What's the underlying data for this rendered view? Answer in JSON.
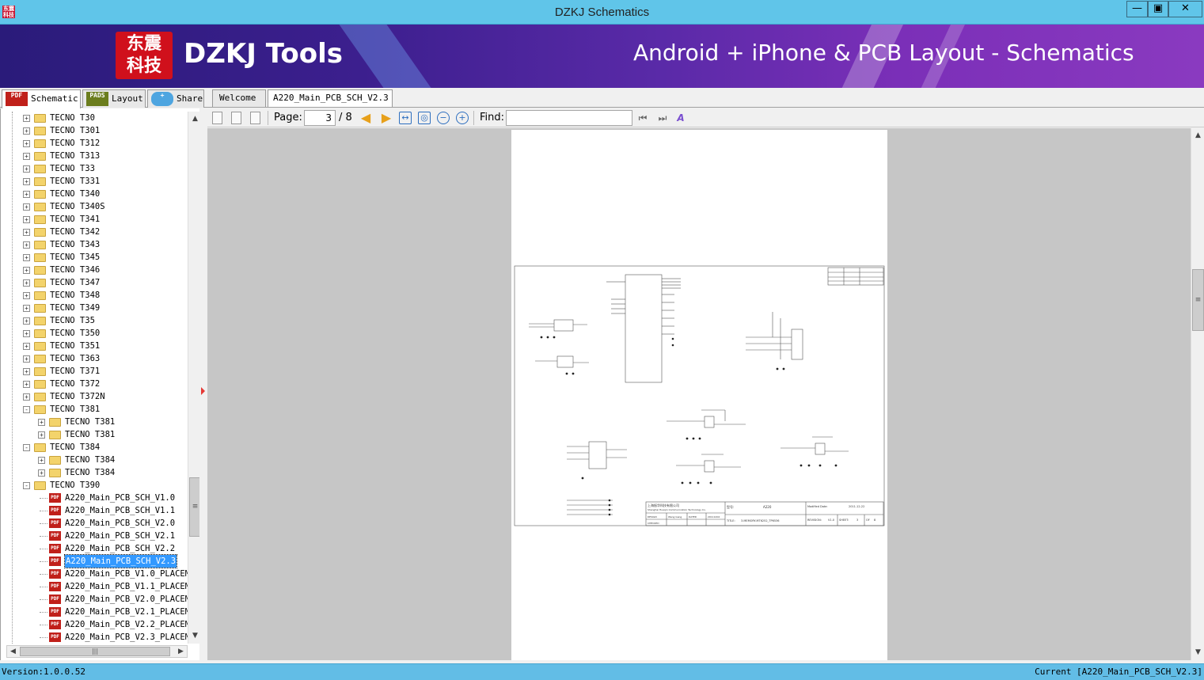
{
  "window": {
    "title": "DZKJ Schematics",
    "icon_text": "东震科技"
  },
  "banner": {
    "logo_line1": "东震",
    "logo_line2": "科技",
    "brand": "DZKJ Tools",
    "tagline": "Android + iPhone & PCB Layout - Schematics"
  },
  "left_tabs": [
    {
      "label": "Schematic",
      "icon": "PDF"
    },
    {
      "label": "Layout",
      "icon": "PADS"
    },
    {
      "label": "Share",
      "icon": "share-icon"
    }
  ],
  "doc_tabs": [
    {
      "label": "Welcome"
    },
    {
      "label": "A220_Main_PCB_SCH_V2.3"
    }
  ],
  "tree": {
    "items": [
      {
        "label": "TECNO T30",
        "level": 0,
        "type": "folder",
        "state": "+"
      },
      {
        "label": "TECNO T301",
        "level": 0,
        "type": "folder",
        "state": "+"
      },
      {
        "label": "TECNO T312",
        "level": 0,
        "type": "folder",
        "state": "+"
      },
      {
        "label": "TECNO T313",
        "level": 0,
        "type": "folder",
        "state": "+"
      },
      {
        "label": "TECNO T33",
        "level": 0,
        "type": "folder",
        "state": "+"
      },
      {
        "label": "TECNO T331",
        "level": 0,
        "type": "folder",
        "state": "+"
      },
      {
        "label": "TECNO T340",
        "level": 0,
        "type": "folder",
        "state": "+"
      },
      {
        "label": "TECNO T340S",
        "level": 0,
        "type": "folder",
        "state": "+"
      },
      {
        "label": "TECNO T341",
        "level": 0,
        "type": "folder",
        "state": "+"
      },
      {
        "label": "TECNO T342",
        "level": 0,
        "type": "folder",
        "state": "+"
      },
      {
        "label": "TECNO T343",
        "level": 0,
        "type": "folder",
        "state": "+"
      },
      {
        "label": "TECNO T345",
        "level": 0,
        "type": "folder",
        "state": "+"
      },
      {
        "label": "TECNO T346",
        "level": 0,
        "type": "folder",
        "state": "+"
      },
      {
        "label": "TECNO T347",
        "level": 0,
        "type": "folder",
        "state": "+"
      },
      {
        "label": "TECNO T348",
        "level": 0,
        "type": "folder",
        "state": "+"
      },
      {
        "label": "TECNO T349",
        "level": 0,
        "type": "folder",
        "state": "+"
      },
      {
        "label": "TECNO T35",
        "level": 0,
        "type": "folder",
        "state": "+"
      },
      {
        "label": "TECNO T350",
        "level": 0,
        "type": "folder",
        "state": "+"
      },
      {
        "label": "TECNO T351",
        "level": 0,
        "type": "folder",
        "state": "+"
      },
      {
        "label": "TECNO T363",
        "level": 0,
        "type": "folder",
        "state": "+"
      },
      {
        "label": "TECNO T371",
        "level": 0,
        "type": "folder",
        "state": "+"
      },
      {
        "label": "TECNO T372",
        "level": 0,
        "type": "folder",
        "state": "+"
      },
      {
        "label": "TECNO T372N",
        "level": 0,
        "type": "folder",
        "state": "+"
      },
      {
        "label": "TECNO T381",
        "level": 0,
        "type": "folder",
        "state": "-"
      },
      {
        "label": "TECNO T381",
        "level": 1,
        "type": "folder",
        "state": "+"
      },
      {
        "label": "TECNO T381",
        "level": 1,
        "type": "folder",
        "state": "+"
      },
      {
        "label": "TECNO T384",
        "level": 0,
        "type": "folder",
        "state": "-"
      },
      {
        "label": "TECNO T384",
        "level": 1,
        "type": "folder",
        "state": "+"
      },
      {
        "label": "TECNO T384",
        "level": 1,
        "type": "folder",
        "state": "+"
      },
      {
        "label": "TECNO T390",
        "level": 0,
        "type": "folder",
        "state": "-"
      },
      {
        "label": "A220_Main_PCB_SCH_V1.0",
        "level": 1,
        "type": "pdf",
        "state": ""
      },
      {
        "label": "A220_Main_PCB_SCH_V1.1",
        "level": 1,
        "type": "pdf",
        "state": ""
      },
      {
        "label": "A220_Main_PCB_SCH_V2.0",
        "level": 1,
        "type": "pdf",
        "state": ""
      },
      {
        "label": "A220_Main_PCB_SCH_V2.1",
        "level": 1,
        "type": "pdf",
        "state": ""
      },
      {
        "label": "A220_Main_PCB_SCH_V2.2",
        "level": 1,
        "type": "pdf",
        "state": ""
      },
      {
        "label": "A220_Main_PCB_SCH_V2.3",
        "level": 1,
        "type": "pdf",
        "state": "",
        "selected": true
      },
      {
        "label": "A220_Main_PCB_V1.0_PLACEME",
        "level": 1,
        "type": "pdf",
        "state": ""
      },
      {
        "label": "A220_Main_PCB_V1.1_PLACEME",
        "level": 1,
        "type": "pdf",
        "state": ""
      },
      {
        "label": "A220_Main_PCB_V2.0_PLACEME",
        "level": 1,
        "type": "pdf",
        "state": ""
      },
      {
        "label": "A220_Main_PCB_V2.1_PLACEME",
        "level": 1,
        "type": "pdf",
        "state": ""
      },
      {
        "label": "A220_Main_PCB_V2.2_PLACEME",
        "level": 1,
        "type": "pdf",
        "state": ""
      },
      {
        "label": "A220_Main_PCB_V2.3_PLACEME",
        "level": 1,
        "type": "pdf",
        "state": ""
      }
    ]
  },
  "toolbar": {
    "page_label": "Page:",
    "page_current": "3",
    "page_total": "/ 8",
    "find_label": "Find:",
    "find_value": ""
  },
  "schematic": {
    "company": "上海振华科技有限公司",
    "company_en": "Shanghai Huaqin Communication Technology Co.",
    "model_label": "型号:",
    "model": "A220",
    "modified_label": "Modified Date:",
    "modified_date": "2011-12-22",
    "title_label": "TITLE:",
    "title": "3.MEMORY-MT6252_TP6536",
    "revision_label": "REVISION:",
    "revision": "V1.0",
    "sheet_label": "SHEET:",
    "sheet": "3",
    "of_label": "OF",
    "of_total": "8",
    "design_label": "DESIGN",
    "designer": "Wang Gang",
    "date_label": "DATED",
    "date": "20111202",
    "checked_label": "CHECKED"
  },
  "status": {
    "version": "Version:1.0.0.52",
    "current": "Current [A220_Main_PCB_SCH_V2.3]"
  },
  "colors": {
    "titlebar": "#60c5e9",
    "statusbar": "#62bde6",
    "selection": "#3399ff",
    "logo_red": "#d0101c"
  }
}
